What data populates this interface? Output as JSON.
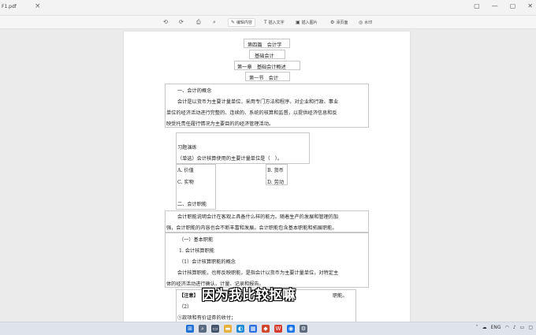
{
  "browser": {
    "tab_title": "F1.pdf",
    "close_glyph": "×",
    "controls": [
      "▢",
      "—",
      "▢",
      "✕"
    ]
  },
  "toolbar": {
    "icons": [
      "undo-icon",
      "redo-icon",
      "print-icon",
      "search-icon"
    ],
    "buttons": [
      {
        "icon": "✎",
        "label": "编辑内容"
      },
      {
        "icon": "T",
        "label": "插入文字"
      },
      {
        "icon": "▣",
        "label": "插入图片"
      },
      {
        "icon": "⚙",
        "label": "添页面"
      },
      {
        "icon": "◎",
        "label": "水印"
      }
    ]
  },
  "document": {
    "part_title": "第四篇　会计学",
    "subject": "基础会计",
    "chapter": "第一章　基础会计概述",
    "section": "第一节　会计",
    "h1": "一、会计的概念",
    "p1_l1": "会计是以货币为主要计量单位，采用专门方法和程序，对企业和行政、事业",
    "p1_l2": "单位的经济活动进行完整的、连续的、系统的核算和监督，以提供经济信息和反",
    "p1_l3": "映受托责任履行情况为主要目的的经济管理活动。",
    "exercise_title": "习题演练",
    "exercise_q": "（单选）会计核算使用的主要计量单位是（　）。",
    "opt_a": "A. 价值",
    "opt_b": "B. 货币",
    "opt_c": "C. 实物",
    "opt_d": "D. 劳动",
    "h2": "二、会计职能",
    "p2_l1": "会计职能说明会计在客观上具备什么样的能力。随着生产的发展和管理的加",
    "p2_l2": "强，会计职能的内容也会不断丰富和发展。会计职能包含基本职能和拓展职能。",
    "h3": "（一）基本职能",
    "h4": "1. 会计核算职能",
    "h5": "（1）会计核算职能的概念",
    "p3_l1": "会计核算职能，也称反映职能，是指会计以货币为主要计量单位，对特定主",
    "p3_l2": "体的经济活动进行确认、计量、记录和报告。",
    "note_l1": "【注意】",
    "note_tail": "职能。",
    "note_l2": "（2）",
    "note_l3": "①款项和有价证券的收付；"
  },
  "subtitle": "因为我比较抠嘛",
  "taskbar": {
    "apps": [
      {
        "name": "windows-start-icon",
        "glyph": "⊞",
        "color": "#1f6fd6"
      },
      {
        "name": "search-icon",
        "glyph": "⌕",
        "color": "#5a6b80"
      },
      {
        "name": "task-view-icon",
        "glyph": "▭",
        "color": "#44546a"
      },
      {
        "name": "file-explorer-icon",
        "glyph": "▬",
        "color": "#e7b13c"
      },
      {
        "name": "edge-browser-icon",
        "glyph": "◐",
        "color": "#1e8bd4"
      },
      {
        "name": "store-icon",
        "glyph": "▦",
        "color": "#2f6fe0"
      },
      {
        "name": "office-icon",
        "glyph": "◆",
        "color": "#d2462c"
      },
      {
        "name": "wps-icon",
        "glyph": "W",
        "color": "#d83b2e"
      },
      {
        "name": "app-icon",
        "glyph": "◉",
        "color": "#1b73e8"
      },
      {
        "name": "gear-icon",
        "glyph": "⚙",
        "color": "#5d6b7d"
      }
    ],
    "lang": "ENG"
  }
}
